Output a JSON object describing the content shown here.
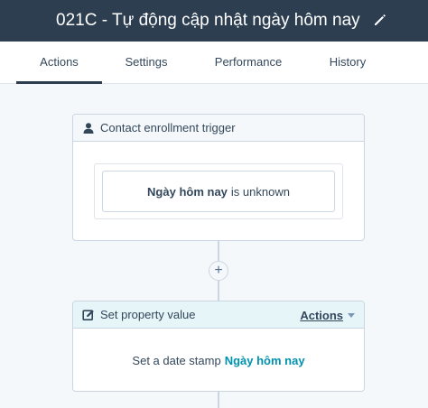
{
  "header": {
    "title": "021C - Tự động cập nhật ngày hôm nay",
    "edit_icon": "pencil-icon"
  },
  "tabs": [
    {
      "label": "Actions",
      "active": true
    },
    {
      "label": "Settings",
      "active": false
    },
    {
      "label": "Performance",
      "active": false
    },
    {
      "label": "History",
      "active": false
    }
  ],
  "trigger": {
    "icon": "contact-icon",
    "title": "Contact enrollment trigger",
    "filter_property": "Ngày hôm nay",
    "filter_condition": "is unknown"
  },
  "add_button": {
    "label": "+"
  },
  "action": {
    "icon": "edit-icon",
    "title": "Set property value",
    "menu_label": "Actions",
    "body_text": "Set a date stamp",
    "body_property": "Ngày hôm nay"
  },
  "colors": {
    "header_bg": "#2d3e50",
    "canvas_bg": "#f5f8fa",
    "action_head_bg": "#e5f5f8",
    "link": "#0091ae",
    "text": "#33475b"
  }
}
